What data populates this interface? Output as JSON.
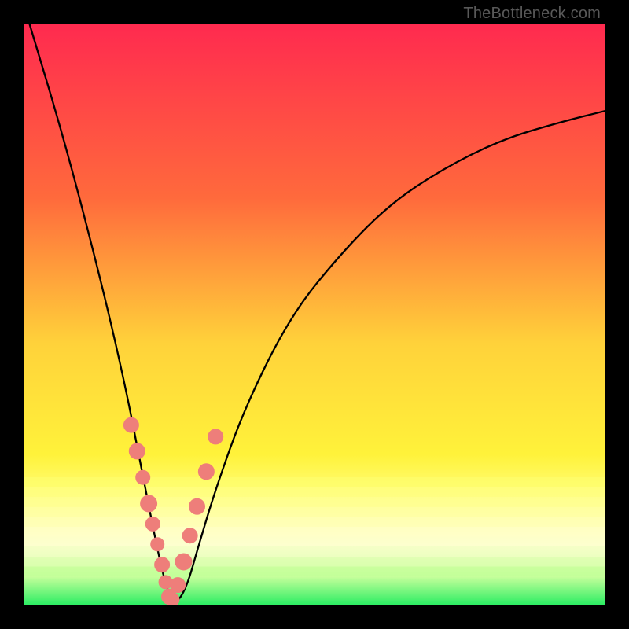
{
  "watermark": "TheBottleneck.com",
  "colors": {
    "background": "#000000",
    "marker": "#ee7e7a",
    "curve": "#000000",
    "gradient_stops": [
      {
        "offset": 0.0,
        "color": "#ff2a4f"
      },
      {
        "offset": 0.3,
        "color": "#ff6a3c"
      },
      {
        "offset": 0.55,
        "color": "#ffd23a"
      },
      {
        "offset": 0.74,
        "color": "#fff23a"
      },
      {
        "offset": 0.82,
        "color": "#ffff80"
      },
      {
        "offset": 0.9,
        "color": "#ffffc8"
      },
      {
        "offset": 0.95,
        "color": "#c8ff9c"
      },
      {
        "offset": 1.0,
        "color": "#29ed62"
      }
    ],
    "striped_band": {
      "top_pct": 78,
      "height_pct": 17,
      "stripes": [
        "#feff6f",
        "#ffff88",
        "#ffff9c",
        "#ffffb0",
        "#ffffc4",
        "#ffffd6",
        "#fbffd6",
        "#ecffc6",
        "#d8ffb0",
        "#beff95"
      ]
    }
  },
  "chart_data": {
    "type": "line",
    "title": "",
    "xlabel": "",
    "ylabel": "",
    "xlim": [
      0,
      1
    ],
    "ylim": [
      0,
      1
    ],
    "notes": "Generic bottleneck-style V-curve. x is normalized horizontal position (0=left, 1=right). y is normalized bottleneck metric (0=bottom/good, 1=top/bad). Minimum near x≈0.25.",
    "series": [
      {
        "name": "curve",
        "x": [
          0.01,
          0.07,
          0.13,
          0.17,
          0.2,
          0.225,
          0.245,
          0.26,
          0.28,
          0.3,
          0.33,
          0.38,
          0.46,
          0.55,
          0.63,
          0.72,
          0.82,
          0.92,
          1.0
        ],
        "values": [
          1.0,
          0.8,
          0.57,
          0.4,
          0.25,
          0.12,
          0.03,
          0.0,
          0.03,
          0.1,
          0.2,
          0.34,
          0.5,
          0.61,
          0.69,
          0.75,
          0.8,
          0.83,
          0.85
        ]
      },
      {
        "name": "markers",
        "x": [
          0.185,
          0.195,
          0.205,
          0.215,
          0.222,
          0.23,
          0.238,
          0.244,
          0.25,
          0.256,
          0.265,
          0.275,
          0.286,
          0.298,
          0.314,
          0.33
        ],
        "values": [
          0.31,
          0.265,
          0.22,
          0.175,
          0.14,
          0.105,
          0.07,
          0.04,
          0.015,
          0.01,
          0.035,
          0.075,
          0.12,
          0.17,
          0.23,
          0.29
        ],
        "radius": [
          9.5,
          10,
          9,
          10.5,
          9,
          8.5,
          9.5,
          8.5,
          9.5,
          8.5,
          9.5,
          10.5,
          9.5,
          10,
          10,
          9.5
        ]
      }
    ]
  }
}
